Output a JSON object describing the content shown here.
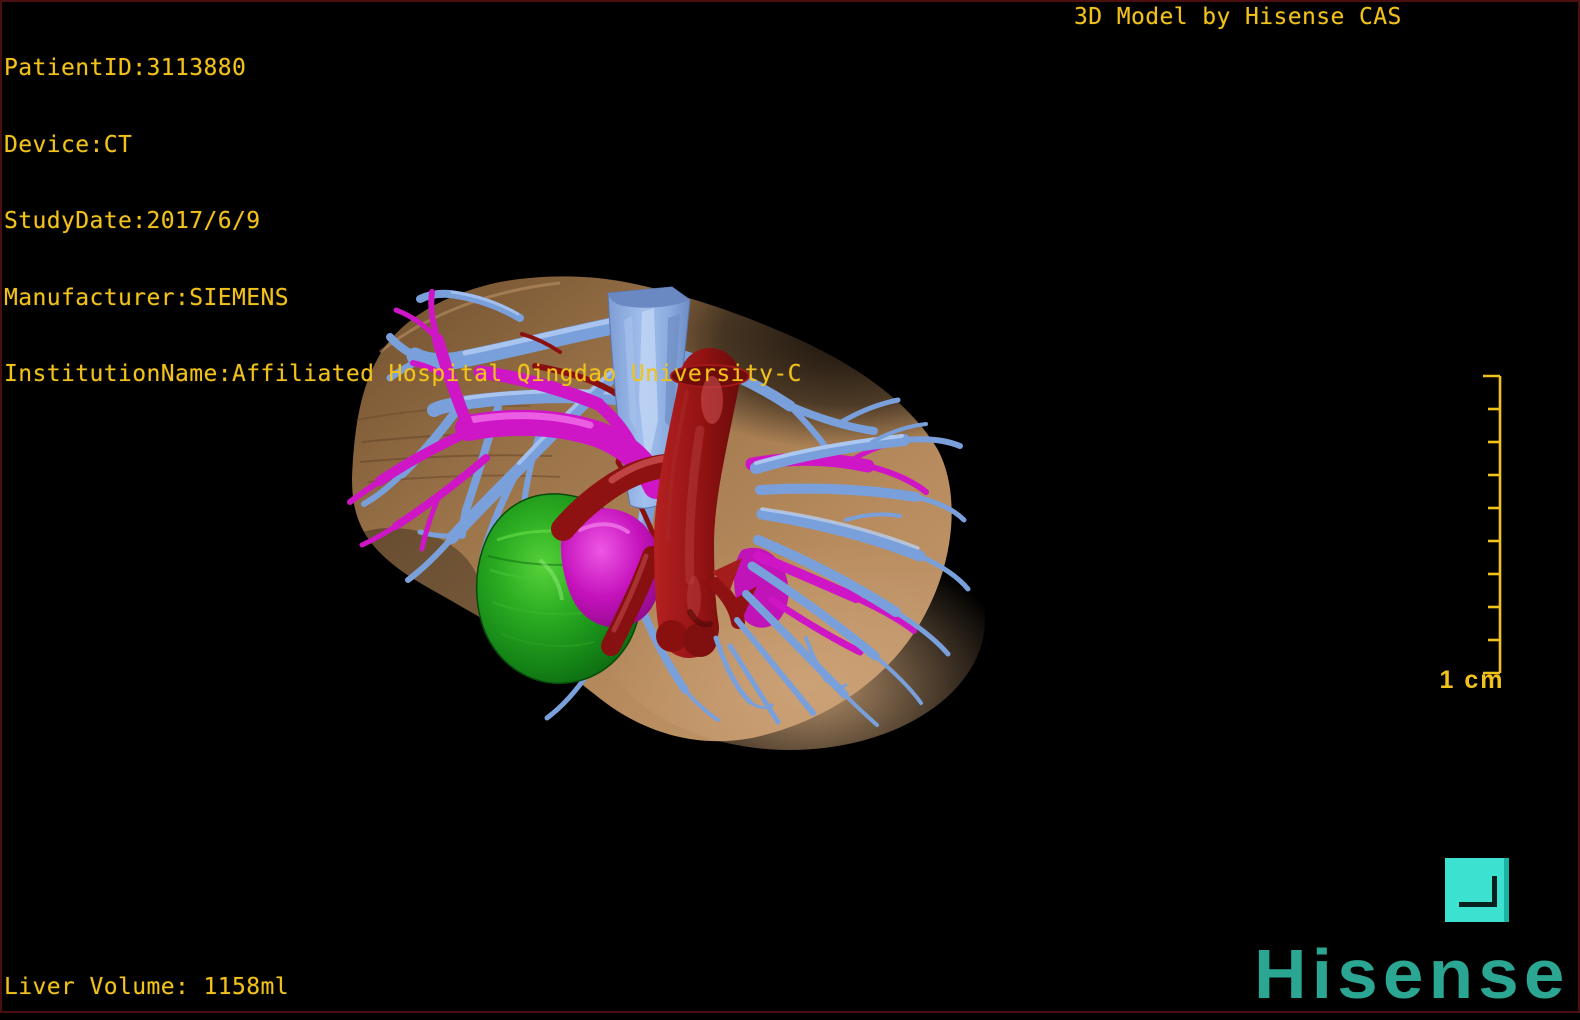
{
  "frame": {
    "border_color": "#4c0f0f",
    "background": "#000000"
  },
  "header": {
    "title": "3D Model by Hisense CAS"
  },
  "patient_info": {
    "lines": [
      "PatientID:3113880",
      "Device:CT",
      "StudyDate:2017/6/9",
      "Manufacturer:SIEMENS",
      "InstitutionName:Affiliated Hospital Qingdao University-C"
    ]
  },
  "readouts": {
    "liver_volume": "Liver Volume: 1158ml"
  },
  "scale_ruler": {
    "label": "1 cm",
    "tick_count": 10,
    "color": "#f2c21c"
  },
  "branding": {
    "logo_text": "Hisense",
    "logo_color": "#2ba693"
  },
  "icons": {
    "orientation_icon": "corner-bracket-icon",
    "orientation_icon_color": "#3ce2cf"
  },
  "overlay_text_color": "#f2c21c",
  "model": {
    "structures": [
      {
        "name": "liver",
        "color": "#b5885a"
      },
      {
        "name": "hepatic-veins",
        "color": "#7aa0dc"
      },
      {
        "name": "portal-vessels",
        "color": "#cf16c6"
      },
      {
        "name": "red-vessel",
        "color": "#8f1212"
      },
      {
        "name": "inferior-vena-cava",
        "color": "#9ab8e8"
      },
      {
        "name": "green-mass",
        "color": "#2cad22"
      }
    ]
  }
}
